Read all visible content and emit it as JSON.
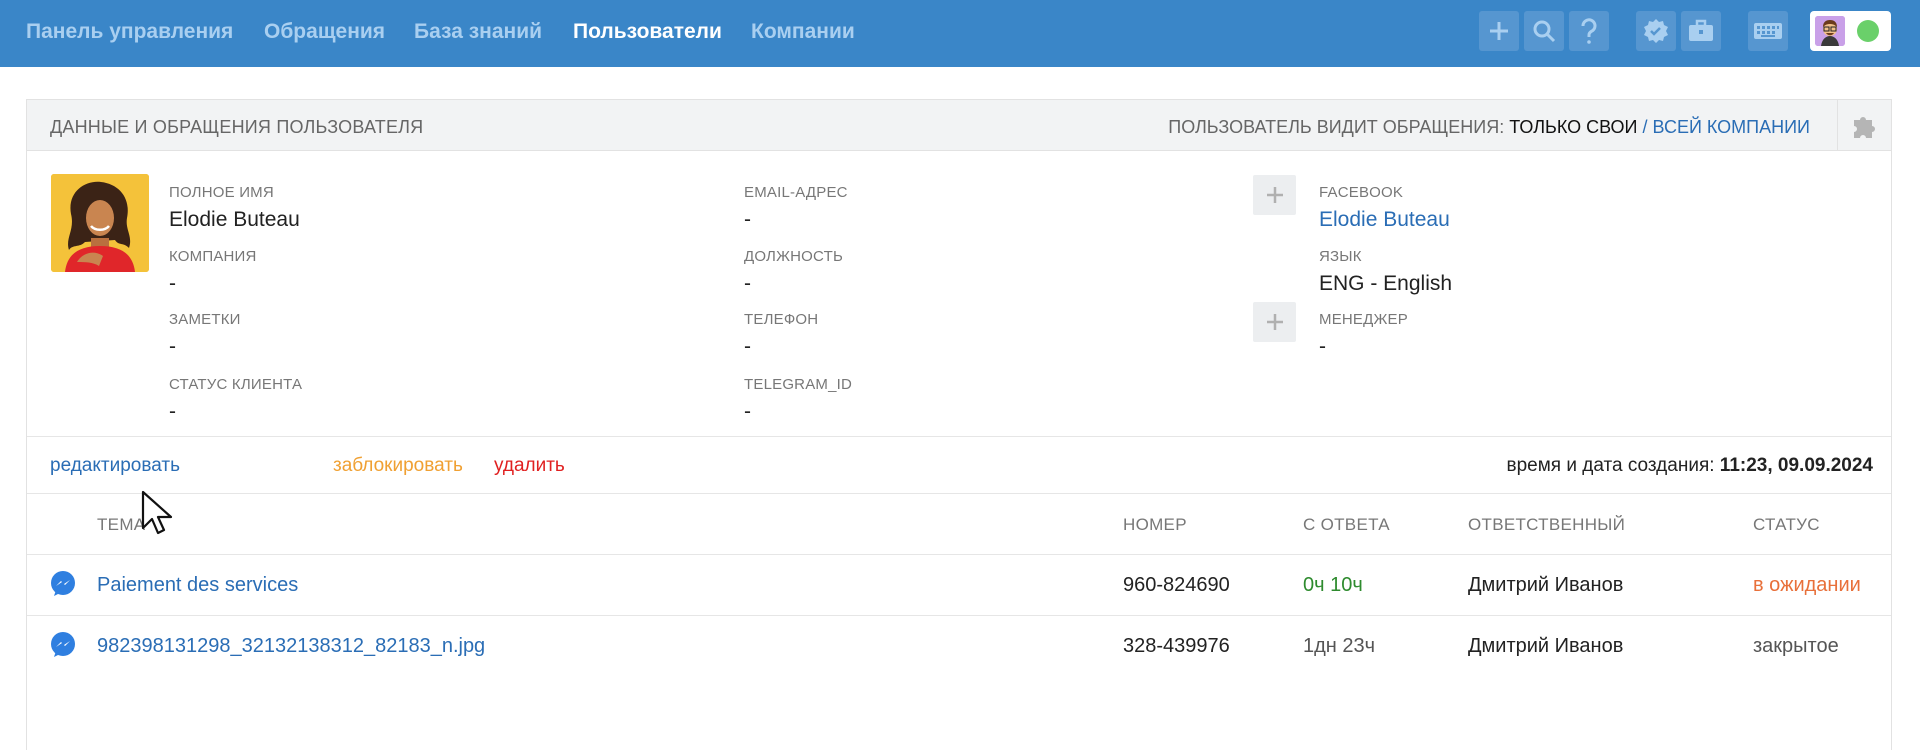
{
  "nav": {
    "items": [
      {
        "label": "Панель управления",
        "active": false
      },
      {
        "label": "Обращения",
        "active": false
      },
      {
        "label": "База знаний",
        "active": false
      },
      {
        "label": "Пользователи",
        "active": true
      },
      {
        "label": "Компании",
        "active": false
      }
    ],
    "toolbar_icons": [
      "plus-icon",
      "search-icon",
      "help-icon",
      "verified-badge-icon",
      "briefcase-icon",
      "keyboard-icon"
    ],
    "status": "online"
  },
  "panel": {
    "title": "ДАННЫЕ И ОБРАЩЕНИЯ ПОЛЬЗОВАТЕЛЯ",
    "visibility_prefix": "ПОЛЬЗОВАТЕЛЬ ВИДИТ ОБРАЩЕНИЯ:",
    "visibility_current": "ТОЛЬКО СВОИ",
    "visibility_separator": "/",
    "visibility_other": "ВСЕЙ КОМПАНИИ"
  },
  "profile": {
    "full_name_label": "ПОЛНОЕ ИМЯ",
    "full_name": "Elodie Buteau",
    "company_label": "КОМПАНИЯ",
    "company": "-",
    "notes_label": "ЗАМЕТКИ",
    "notes": "-",
    "client_status_label": "СТАТУС КЛИЕНТА",
    "client_status": "-",
    "email_label": "EMAIL-АДРЕС",
    "email": "-",
    "position_label": "ДОЛЖНОСТЬ",
    "position": "-",
    "phone_label": "ТЕЛЕФОН",
    "phone": "-",
    "telegram_label": "TELEGRAM_ID",
    "telegram": "-",
    "facebook_label": "FACEBOOK",
    "facebook": "Elodie Buteau",
    "language_label": "ЯЗЫК",
    "language": "ENG - English",
    "manager_label": "МЕНЕДЖЕР",
    "manager": "-"
  },
  "actions": {
    "edit": "редактировать",
    "block": "заблокировать",
    "delete": "удалить",
    "created_label": "время и дата создания:",
    "created_value": "11:23, 09.09.2024"
  },
  "tickets": {
    "columns": [
      "ТЕМА",
      "НОМЕР",
      "С ОТВЕТА",
      "ОТВЕТСТВЕННЫЙ",
      "СТАТУС"
    ],
    "rows": [
      {
        "channel": "messenger-icon",
        "subject": "Paiement des services",
        "number": "960-824690",
        "since_reply": "0ч 10ч",
        "assignee": "Дмитрий Иванов",
        "status": "в ожидании"
      },
      {
        "channel": "messenger-icon",
        "subject": "982398131298_32132138312_82183_n.jpg",
        "number": "328-439976",
        "since_reply": "1дн 23ч",
        "assignee": "Дмитрий Иванов",
        "status": "закрытое"
      }
    ]
  },
  "colors": {
    "header_bg": "#3a86c8",
    "link": "#2a6db5",
    "block_action": "#f0a032",
    "delete_action": "#e02020",
    "since_reply_fresh": "#2e8b2e",
    "status_pending": "#e8703a",
    "status_closed": "#555555"
  }
}
